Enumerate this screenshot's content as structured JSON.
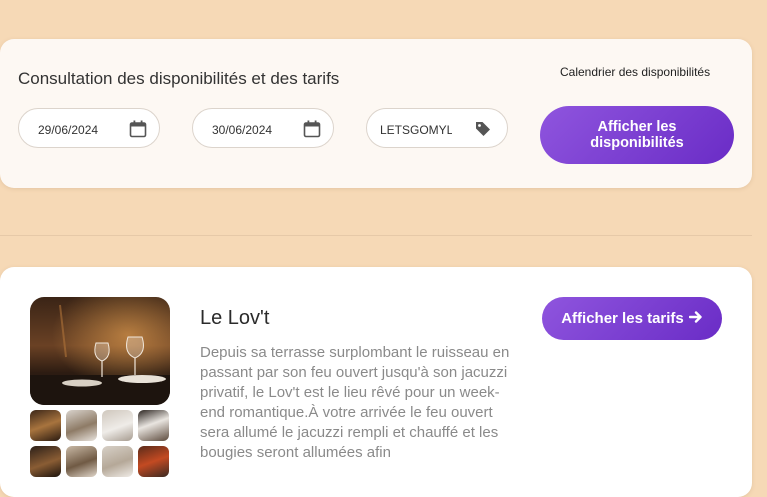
{
  "search": {
    "title": "Consultation des disponibilités et des tarifs",
    "calendar_link": "Calendrier des disponibilités",
    "arrival_date": "29/06/2024",
    "departure_date": "30/06/2024",
    "promo_code": "LETSGOMYL",
    "submit_label": "Afficher les disponibilités",
    "icons": {
      "date": "calendar-icon",
      "promo": "tag-icon"
    }
  },
  "room": {
    "name": "Le Lov't",
    "description": "Depuis sa terrasse surplombant le ruisseau en passant par son feu ouvert jusqu'à son jacuzzi privatif, le Lov't est le lieu rêvé pour un week-end romantique.À votre arrivée le feu ouvert sera allumé le jacuzzi rempli et chauffé et les bougies seront allumées afin",
    "rates_label": "Afficher les tarifs",
    "rates_icon": "arrow-right-icon"
  },
  "colors": {
    "accent": "#7a3fd3",
    "page_background": "#f6d9b6"
  }
}
